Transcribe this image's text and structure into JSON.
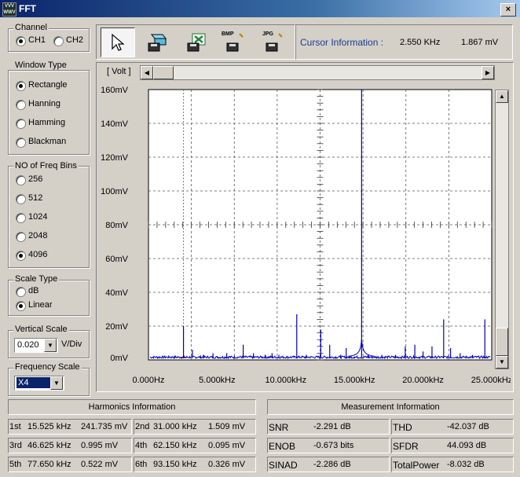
{
  "window": {
    "title": "FFT",
    "icon_label": "VVV WWV",
    "close_glyph": "×"
  },
  "channel": {
    "title": "Channel",
    "options": [
      "CH1",
      "CH2"
    ],
    "selected": "CH1"
  },
  "window_type": {
    "title": "Window Type",
    "options": [
      "Rectangle",
      "Hanning",
      "Hamming",
      "Blackman"
    ],
    "selected": "Rectangle"
  },
  "freq_bins": {
    "title": "NO of Freq Bins",
    "options": [
      "256",
      "512",
      "1024",
      "2048",
      "4096"
    ],
    "selected": "4096"
  },
  "scale_type": {
    "title": "Scale Type",
    "options": [
      "dB",
      "Linear"
    ],
    "selected": "Linear"
  },
  "vertical_scale": {
    "title": "Vertical Scale",
    "value": "0.020",
    "unit": "V/Div"
  },
  "frequency_scale": {
    "title": "Frequency Scale",
    "value": "X4"
  },
  "toolbar": {
    "icons": [
      "cursor-arrow-icon",
      "eraser-icon",
      "excel-export-icon",
      "bmp-export-icon",
      "jpg-export-icon"
    ],
    "bmp_label": "BMP",
    "jpg_label": "JPG"
  },
  "cursor_info": {
    "label": "Cursor Information :",
    "freq": "2.550 KHz",
    "value": "1.867 mV"
  },
  "plot": {
    "unit_label": "[ Volt ]"
  },
  "chart_data": {
    "type": "line",
    "xlabel": "",
    "ylabel": "[ Volt ]",
    "x_ticks": [
      "0.000Hz",
      "5.000kHz",
      "10.000kHz",
      "15.000kHz",
      "20.000kHz",
      "25.000kHz"
    ],
    "y_ticks": [
      "0mV",
      "20mV",
      "40mV",
      "60mV",
      "80mV",
      "100mV",
      "120mV",
      "140mV",
      "160mV"
    ],
    "xlim": [
      0,
      25000
    ],
    "ylim": [
      0,
      160
    ],
    "grid": true,
    "cursor_x": 2550,
    "series": [
      {
        "color": "#0000c0",
        "peaks": [
          {
            "x": 2550,
            "y": 20
          },
          {
            "x": 3200,
            "y": 6
          },
          {
            "x": 4000,
            "y": 3
          },
          {
            "x": 4700,
            "y": 4
          },
          {
            "x": 5700,
            "y": 4
          },
          {
            "x": 6900,
            "y": 9
          },
          {
            "x": 7650,
            "y": 4
          },
          {
            "x": 8500,
            "y": 3
          },
          {
            "x": 9000,
            "y": 4
          },
          {
            "x": 9500,
            "y": 3
          },
          {
            "x": 10800,
            "y": 27
          },
          {
            "x": 11500,
            "y": 3
          },
          {
            "x": 12550,
            "y": 18
          },
          {
            "x": 13200,
            "y": 9
          },
          {
            "x": 14000,
            "y": 3
          },
          {
            "x": 14400,
            "y": 7
          },
          {
            "x": 15000,
            "y": 2
          },
          {
            "x": 15525,
            "y": 160
          },
          {
            "x": 16000,
            "y": 3
          },
          {
            "x": 17000,
            "y": 3
          },
          {
            "x": 18000,
            "y": 3
          },
          {
            "x": 18700,
            "y": 8
          },
          {
            "x": 19400,
            "y": 9
          },
          {
            "x": 20000,
            "y": 5
          },
          {
            "x": 20650,
            "y": 8
          },
          {
            "x": 21500,
            "y": 24
          },
          {
            "x": 22000,
            "y": 7
          },
          {
            "x": 22700,
            "y": 4
          },
          {
            "x": 23600,
            "y": 3
          },
          {
            "x": 24500,
            "y": 24
          }
        ]
      }
    ]
  },
  "harmonics": {
    "title": "Harmonics Information",
    "rows": [
      [
        {
          "label": "1st",
          "freq": "15.525 kHz",
          "value": "241.735 mV"
        },
        {
          "label": "2nd",
          "freq": "31.000 kHz",
          "value": "1.509 mV"
        }
      ],
      [
        {
          "label": "3rd",
          "freq": "46.625 kHz",
          "value": "0.995 mV"
        },
        {
          "label": "4th",
          "freq": "62.150 kHz",
          "value": "0.095 mV"
        }
      ],
      [
        {
          "label": "5th",
          "freq": "77.650 kHz",
          "value": "0.522 mV"
        },
        {
          "label": "6th",
          "freq": "93.150 kHz",
          "value": "0.326 mV"
        }
      ]
    ]
  },
  "measurement": {
    "title": "Measurement Information",
    "rows": [
      [
        {
          "label": "SNR",
          "value": "-2.291 dB"
        },
        {
          "label": "THD",
          "value": "-42.037 dB"
        }
      ],
      [
        {
          "label": "ENOB",
          "value": "-0.673 bits"
        },
        {
          "label": "SFDR",
          "value": "44.093 dB"
        }
      ],
      [
        {
          "label": "SINAD",
          "value": "-2.286 dB"
        },
        {
          "label": "TotalPower",
          "value": "-8.032 dB"
        }
      ]
    ]
  }
}
